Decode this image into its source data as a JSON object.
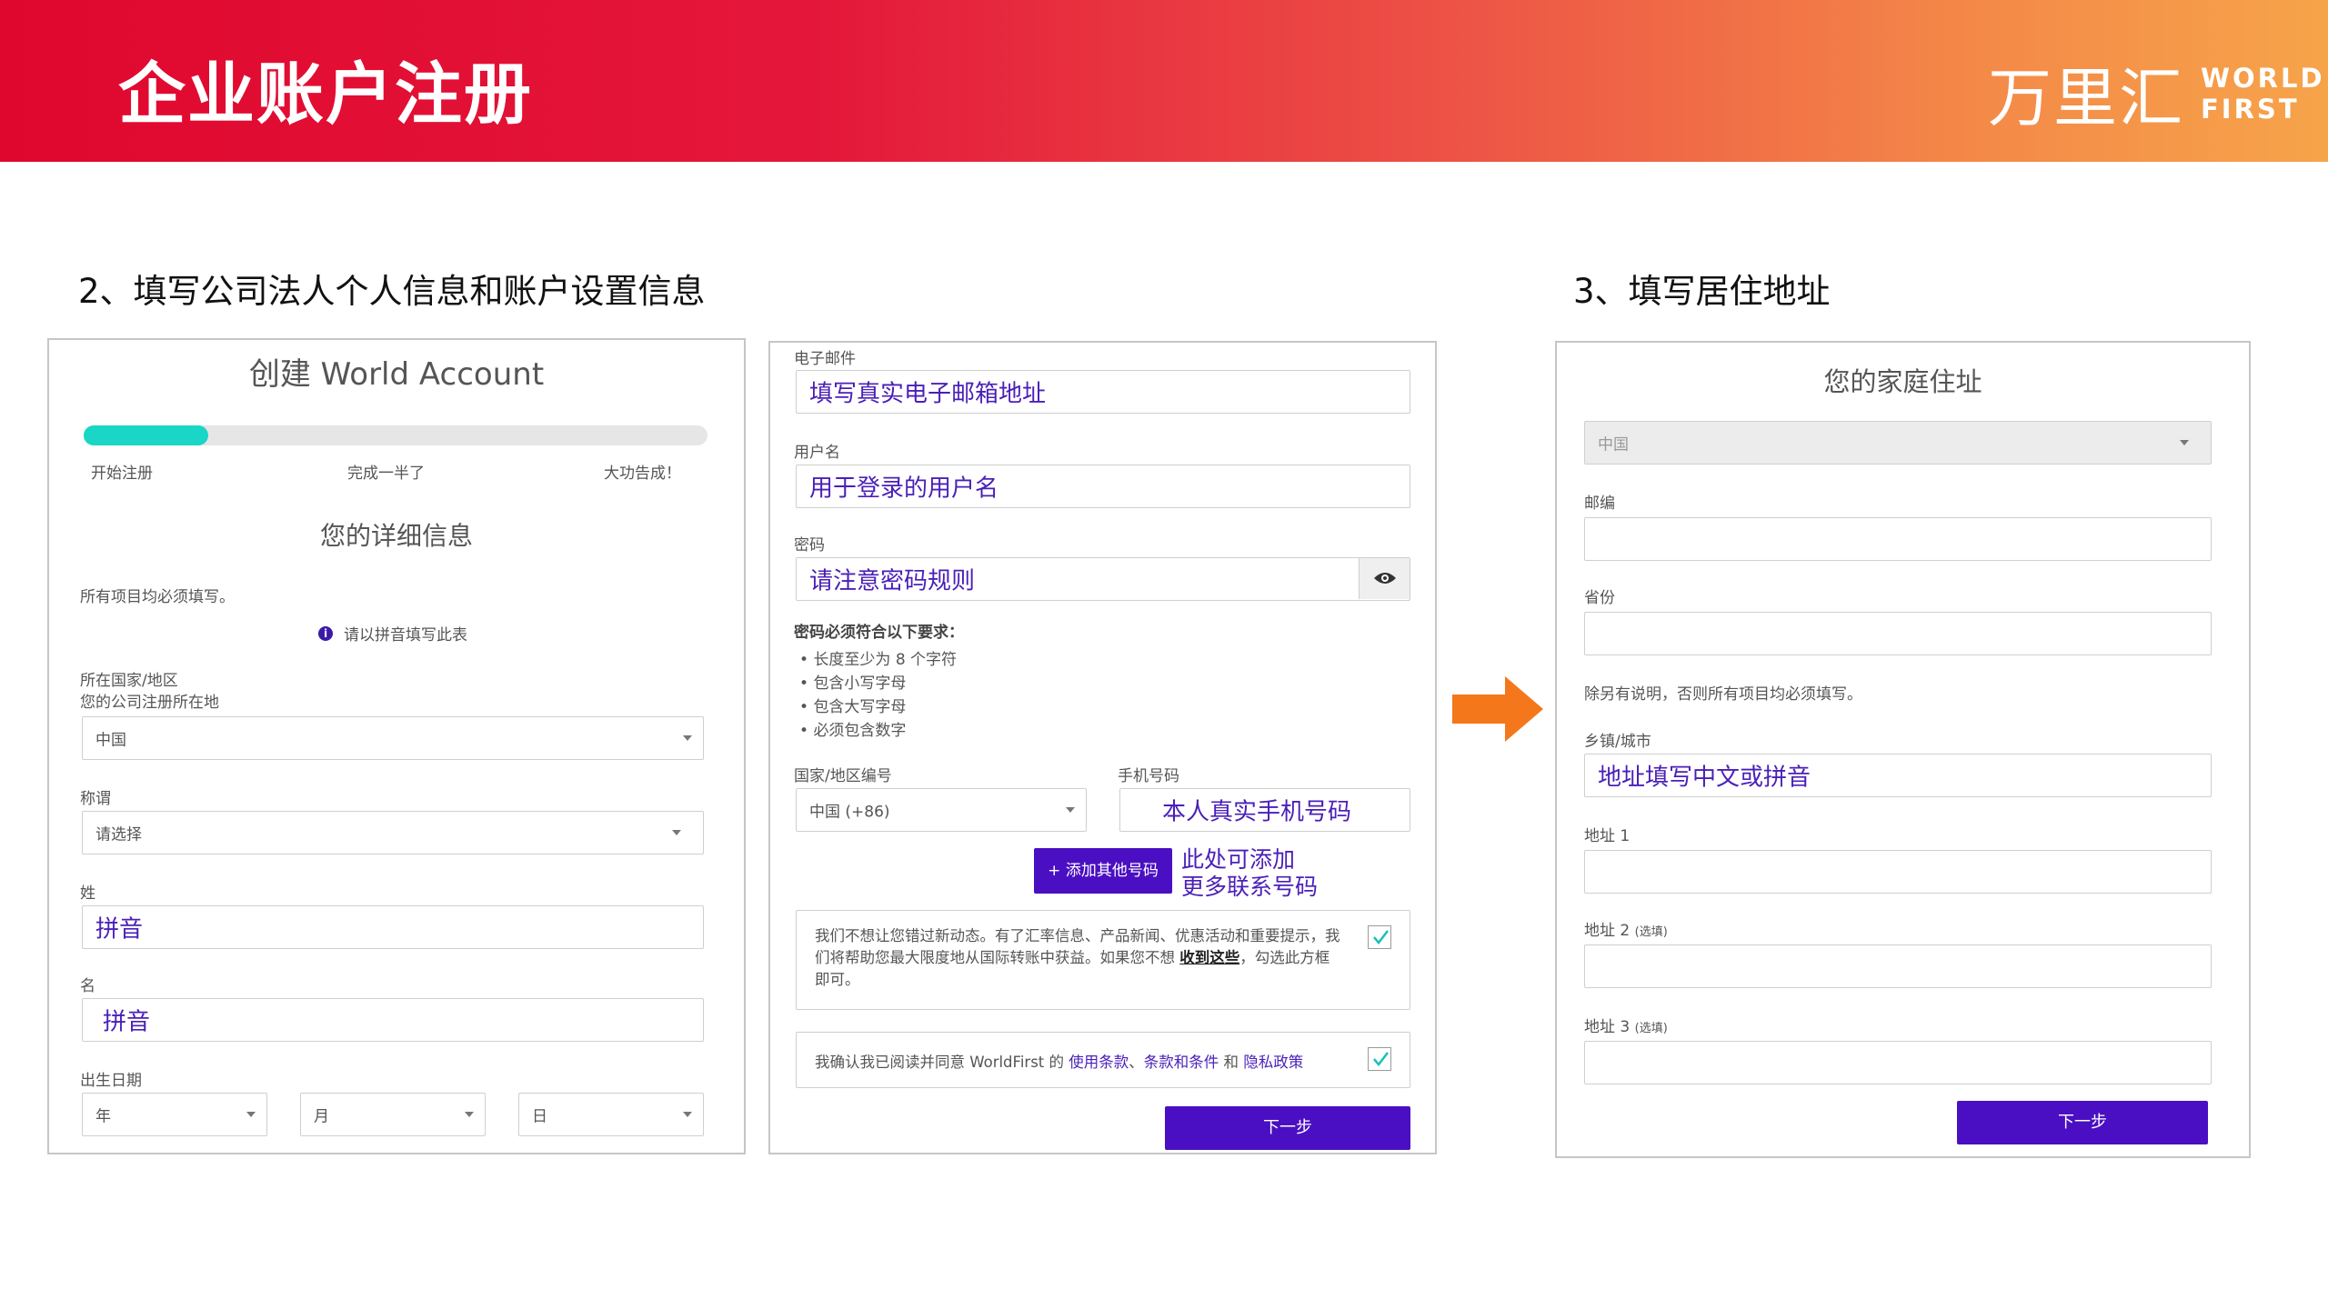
{
  "header": {
    "title": "企业账户注册",
    "logo_cn": "万里汇",
    "logo_en_1": "WORLD",
    "logo_en_2": "FIRST"
  },
  "step2": {
    "title": "2、填写公司法人个人信息和账户设置信息"
  },
  "step3": {
    "title": "3、填写居住地址"
  },
  "panel1": {
    "heading": "创建 World Account",
    "progress": {
      "fraction": 0.2,
      "steps": [
        "开始注册",
        "完成一半了",
        "大功告成！"
      ]
    },
    "section_title": "您的详细信息",
    "required_note": "所有项目均必须填写。",
    "pinyin_note": "请以拼音填写此表",
    "country_label_1": "所在国家/地区",
    "country_label_2": "您的公司注册所在地",
    "country_value": "中国",
    "salutation_label": "称谓",
    "salutation_value": "请选择",
    "surname_label": "姓",
    "surname_value": "拼音",
    "given_label": "名",
    "given_value": "拼音",
    "dob_label": "出生日期",
    "dob_year": "年",
    "dob_month": "月",
    "dob_day": "日"
  },
  "panel2": {
    "email_label": "电子邮件",
    "email_value": "填写真实电子邮箱地址",
    "username_label": "用户名",
    "username_value": "用于登录的用户名",
    "password_label": "密码",
    "password_value": "请注意密码规则",
    "pw_rules_title": "密码必须符合以下要求：",
    "pw_rules": [
      "长度至少为 8 个字符",
      "包含小写字母",
      "包含大写字母",
      "必须包含数字"
    ],
    "country_code_label": "国家/地区编号",
    "country_code_value": "中国 (+86)",
    "phone_label": "手机号码",
    "phone_value": "本人真实手机号码",
    "add_phone_button": "+ 添加其他号码",
    "add_phone_note_1": "此处可添加",
    "add_phone_note_2": "更多联系号码",
    "marketing_text_1": "我们不想让您错过新动态。有了汇率信息、产品新闻、优惠活动和重要提示，我",
    "marketing_text_2": "们将帮助您最大限度地从国际转账中获益。如果您不想",
    "marketing_bold": "收到这些",
    "marketing_text_3": "，勾选此方框即",
    "marketing_text_4": "可。",
    "terms_text_1": "我确认我已阅读并同意 WorldFirst 的",
    "terms_link_1": "使用条款",
    "terms_sep": "、",
    "terms_link_2": "条款和条件",
    "terms_and": "和",
    "terms_link_3": "隐私政策",
    "next_button": "下一步"
  },
  "panel3": {
    "heading": "您的家庭住址",
    "country_value": "中国",
    "postcode_label": "邮编",
    "province_label": "省份",
    "required_note": "除另有说明，否则所有项目均必须填写。",
    "city_label": "乡镇/城市",
    "city_value": "地址填写中文或拼音",
    "address1_label": "地址 1",
    "address2_label": "地址 2",
    "address2_optional": "(选填)",
    "address3_label": "地址 3",
    "address3_optional": "(选填)",
    "next_button": "下一步"
  },
  "colors": {
    "accent_purple": "#4a0fc2",
    "progress_teal": "#19d6c6",
    "arrow_orange": "#f5771c"
  }
}
